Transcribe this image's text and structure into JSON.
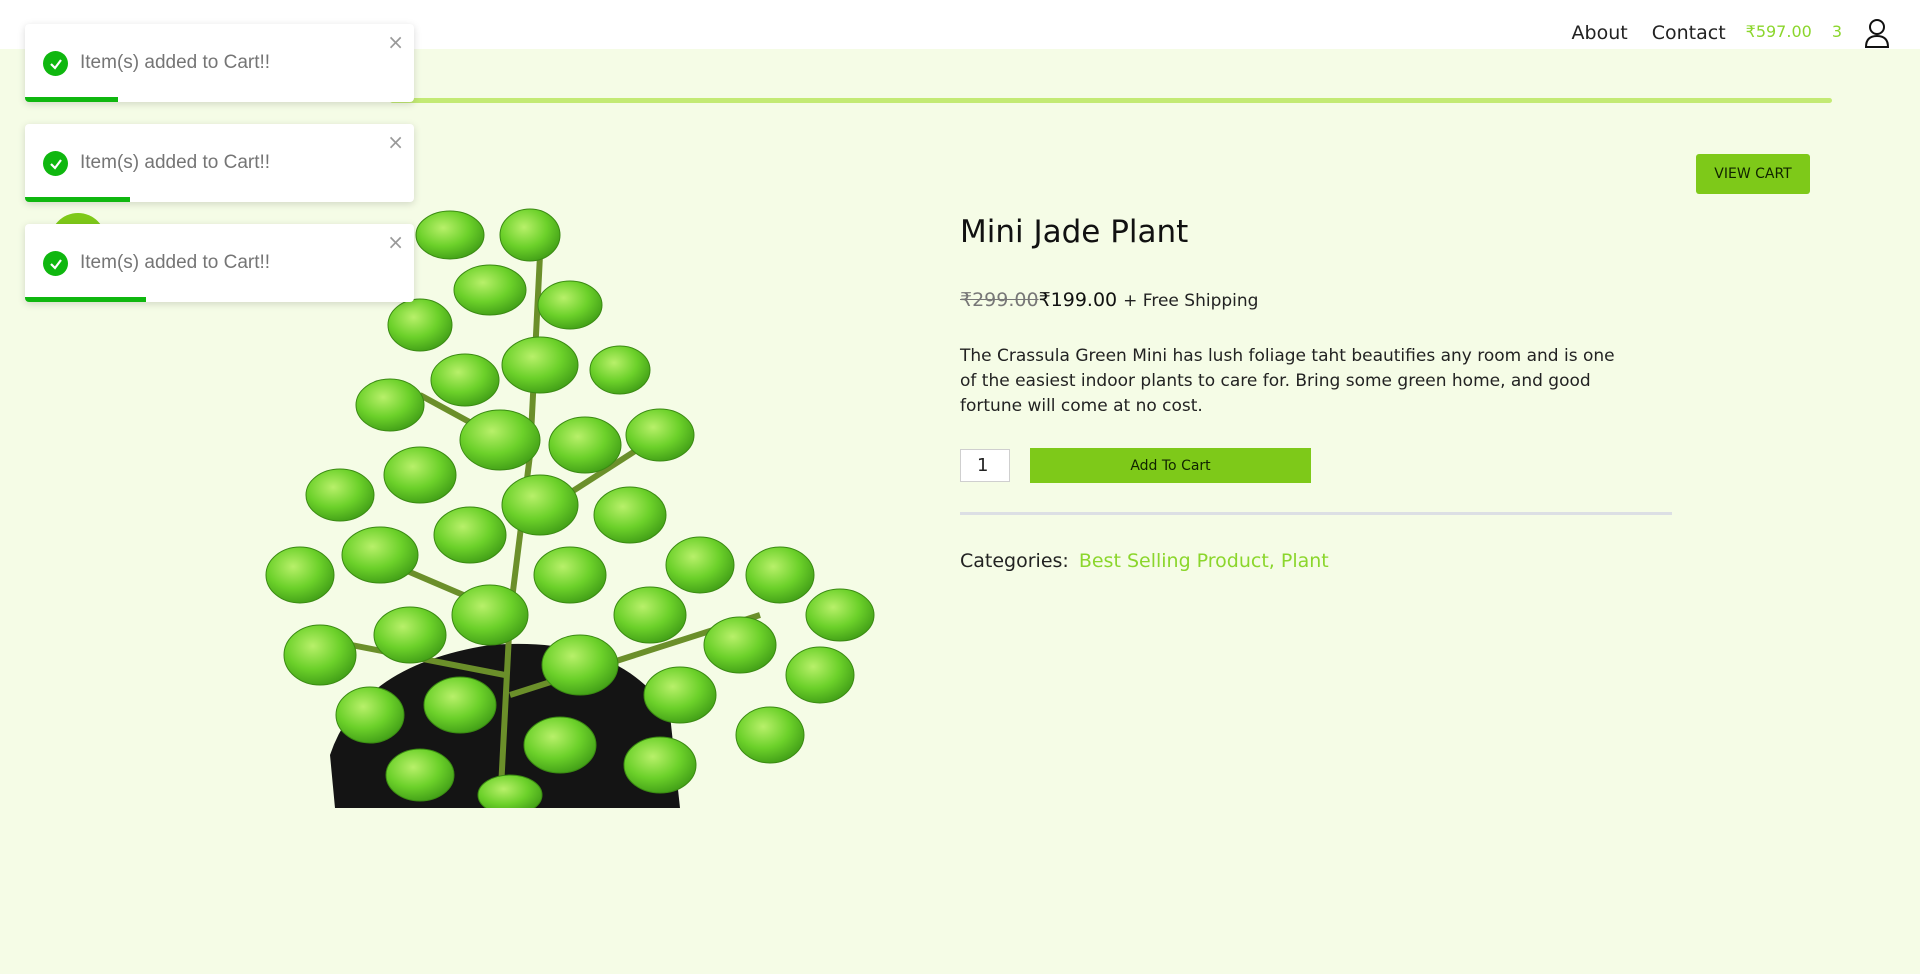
{
  "nav": {
    "about": "About",
    "contact": "Contact",
    "cart_total": "₹597.00",
    "cart_count": "3"
  },
  "cart": {
    "view_cart_label": "VIEW CART"
  },
  "product": {
    "title": "Mini Jade Plant",
    "old_price": "₹299.00",
    "new_price": "₹199.00",
    "shipping": "+ Free Shipping",
    "description": "The Crassula Green Mini has lush foliage taht beautifies any room and is one of the easiest indoor plants to care for. Bring some green home, and good fortune will come at no cost.",
    "quantity": "1",
    "add_to_cart_label": "Add To Cart",
    "categories_label": "Categories:",
    "categories": "Best Selling Product, Plant"
  },
  "toasts": [
    {
      "message": "Item(s) added to Cart!!",
      "close": "×",
      "progress": 0.24
    },
    {
      "message": "Item(s) added to Cart!!",
      "close": "×",
      "progress": 0.27
    },
    {
      "message": "Item(s) added to Cart!!",
      "close": "×",
      "progress": 0.31
    }
  ],
  "colors": {
    "accent": "#7ec919",
    "link": "#8bd62c",
    "success": "#0fb70f",
    "page_bg": "#f5fce6"
  },
  "icons": {
    "user": "user-icon",
    "check": "check-icon",
    "close": "close-icon"
  }
}
